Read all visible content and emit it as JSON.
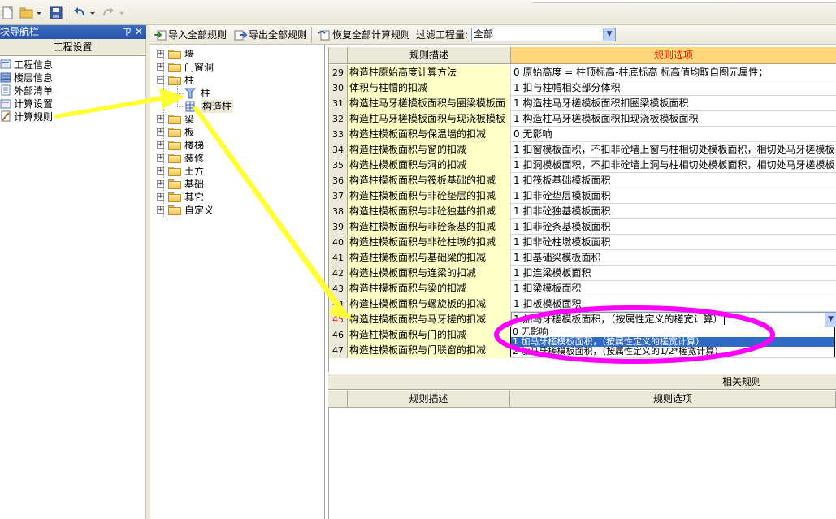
{
  "nav": {
    "title": "块导航栏",
    "pin": "ㄗ",
    "close": "✕",
    "header": "工程设置",
    "items": [
      {
        "label": "工程信息",
        "icon": "info-icon"
      },
      {
        "label": "楼层信息",
        "icon": "floor-icon"
      },
      {
        "label": "外部清单",
        "icon": "list-icon"
      },
      {
        "label": "计算设置",
        "icon": "calc-settings-icon"
      },
      {
        "label": "计算规则",
        "icon": "calc-rules-icon"
      }
    ]
  },
  "toolbar": {
    "import_label": "导入全部规则",
    "export_label": "导出全部规则",
    "restore_label": "恢复全部计算规则",
    "filter_label": "过滤工程量:",
    "filter_value": "全部"
  },
  "tree": {
    "items": [
      {
        "label": "墙",
        "expanded": false
      },
      {
        "label": "门窗洞",
        "expanded": false
      },
      {
        "label": "柱",
        "expanded": true
      },
      {
        "label": "柱",
        "child": true
      },
      {
        "label": "构造柱",
        "child": true,
        "selected": true
      },
      {
        "label": "梁",
        "expanded": false
      },
      {
        "label": "板",
        "expanded": false
      },
      {
        "label": "楼梯",
        "expanded": false
      },
      {
        "label": "装修",
        "expanded": false
      },
      {
        "label": "土方",
        "expanded": false
      },
      {
        "label": "基础",
        "expanded": false
      },
      {
        "label": "其它",
        "expanded": false
      },
      {
        "label": "自定义",
        "expanded": false
      }
    ]
  },
  "grid": {
    "col_desc": "规则描述",
    "col_opt": "规则选项",
    "rows": [
      {
        "num": "29",
        "desc": "构造柱原始高度计算方法",
        "opt": "0 原始高度 = 柱顶标高-柱底标高  标高值均取自图元属性；"
      },
      {
        "num": "30",
        "desc": "体积与柱帽的扣减",
        "opt": "1 扣与柱帽相交部分体积"
      },
      {
        "num": "31",
        "desc": "构造柱马牙槎模板面积与圈梁模板面",
        "opt": "1  构造柱马牙槎模板面积扣圈梁模板面积"
      },
      {
        "num": "32",
        "desc": "构造柱马牙槎模板面积与现浇板模板",
        "opt": "1  构造柱马牙槎模板面积扣现浇板模板面积"
      },
      {
        "num": "33",
        "desc": "构造柱模板面积与保温墙的扣减",
        "opt": "0   无影响"
      },
      {
        "num": "34",
        "desc": "构造柱模板面积与窗的扣减",
        "opt": "1 扣窗模板面积，不扣非砼墙上窗与柱相切处模板面积，相切处马牙槎模板"
      },
      {
        "num": "35",
        "desc": "构造柱模板面积与洞的扣减",
        "opt": "1 扣洞模板面积，不扣非砼墙上洞与柱相切处模板面积，相切处马牙槎模板"
      },
      {
        "num": "36",
        "desc": "构造柱模板面积与筏板基础的扣减",
        "opt": "1 扣筏板基础模板面积"
      },
      {
        "num": "37",
        "desc": "构造柱模板面积与非砼垫层的扣减",
        "opt": "1 扣非砼垫层模板面积"
      },
      {
        "num": "38",
        "desc": "构造柱模板面积与非砼独基的扣减",
        "opt": "1 扣非砼独基模板面积"
      },
      {
        "num": "39",
        "desc": "构造柱模板面积与非砼条基的扣减",
        "opt": "1 扣非砼条基模板面积"
      },
      {
        "num": "40",
        "desc": "构造柱模板面积与非砼柱墩的扣减",
        "opt": "1 扣非砼柱墩模板面积"
      },
      {
        "num": "41",
        "desc": "构造柱模板面积与基础梁的扣减",
        "opt": "1 扣基础梁模板面积"
      },
      {
        "num": "42",
        "desc": "构造柱模板面积与连梁的扣减",
        "opt": "1 扣连梁模板面积"
      },
      {
        "num": "43",
        "desc": "构造柱模板面积与梁的扣减",
        "opt": "1 扣梁模板面积"
      },
      {
        "num": "44",
        "desc": "构造柱模板面积与螺旋板的扣减",
        "opt": "1 扣板模板面积"
      },
      {
        "num": "45",
        "desc": "构造柱模板面积与马牙槎的扣减",
        "opt": "1  加马牙槎模板面积，（按属性定义的槎宽计算）|",
        "current": true
      },
      {
        "num": "46",
        "desc": "构造柱模板面积与门的扣减",
        "opt": ""
      },
      {
        "num": "47",
        "desc": "构造柱模板面积与门联窗的扣减",
        "opt": ""
      }
    ],
    "dropdown": [
      {
        "label": "0  无影响"
      },
      {
        "label": "1  加马牙槎模板面积，（按属性定义的槎宽计算）",
        "selected": true
      },
      {
        "label": "2  加马牙槎模板面积，（按属性定义的1/2*槎宽计算）"
      }
    ]
  },
  "related": {
    "title": "相关规则",
    "col_desc": "规则描述",
    "col_opt": "规则选项"
  },
  "colors": {
    "arrow": "#ffff33",
    "ellipse": "#ff00ff",
    "desc_bg": "#ffffc8",
    "header_hl": "#ffd57a",
    "header_hl_text": "#e61900"
  }
}
